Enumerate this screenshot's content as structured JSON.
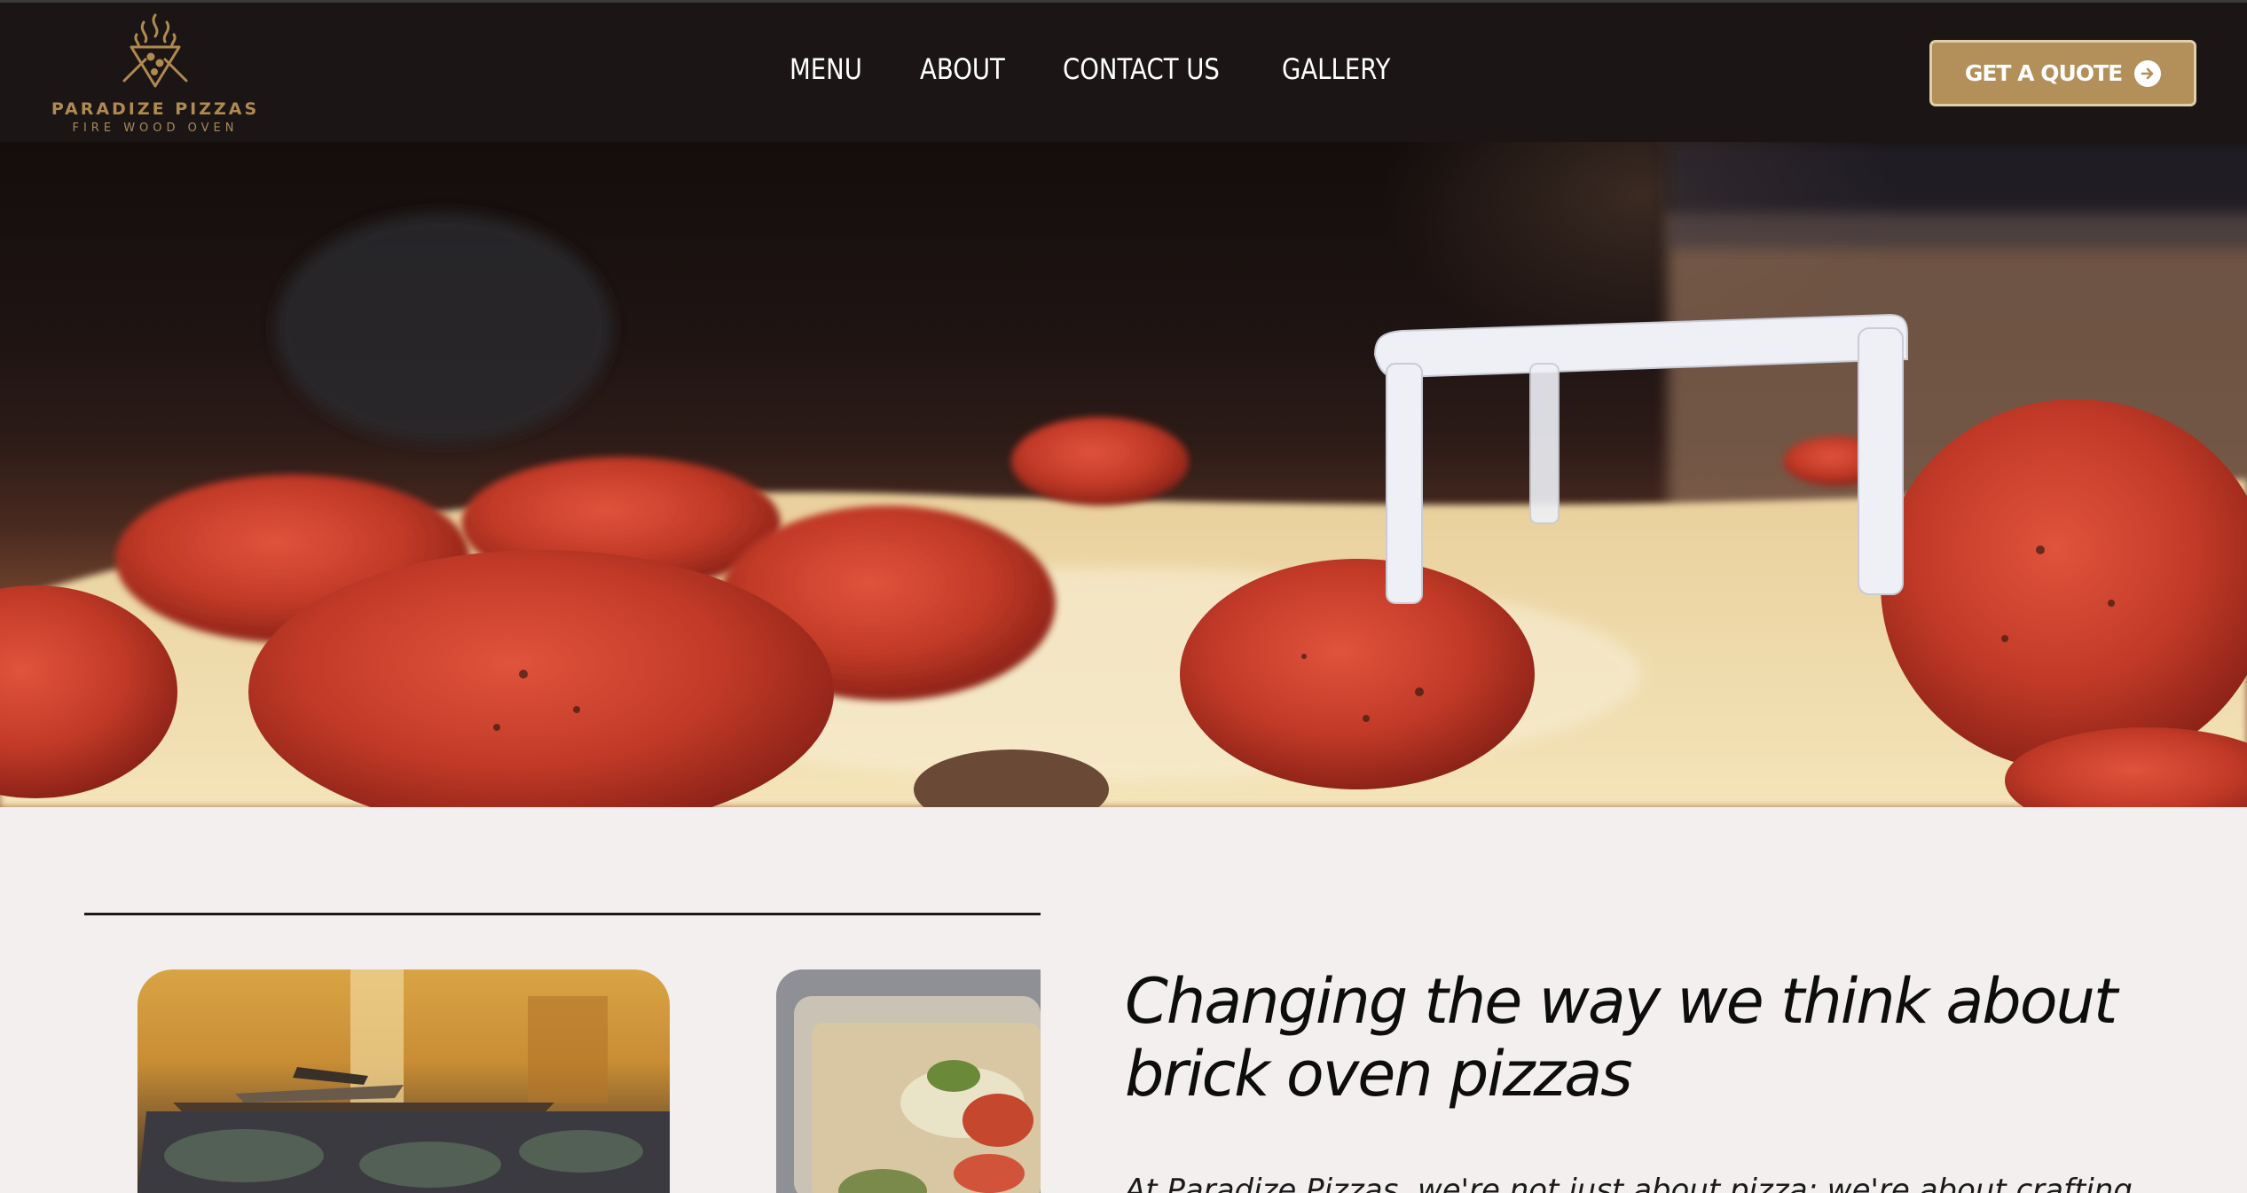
{
  "brand": {
    "name": "PARADIZE PIZZAS",
    "tagline": "FIRE WOOD OVEN",
    "logo_icon": "pizza-flame-logo",
    "accent_color": "#b08a4e",
    "header_bg": "#1b1515"
  },
  "nav": {
    "items": [
      {
        "label": "MENU"
      },
      {
        "label": "ABOUT"
      },
      {
        "label": "CONTACT US"
      },
      {
        "label": "GALLERY"
      }
    ]
  },
  "cta": {
    "label": "GET A QUOTE",
    "icon": "arrow-right-circle-icon",
    "bg_color": "#b38f5a"
  },
  "hero": {
    "image": "pepperoni-pizza-closeup"
  },
  "about": {
    "headline": "Changing the way we think about brick oven pizzas",
    "intro": "At Paradize Pizzas, we're not just about pizza; we're about crafting",
    "photo_left": "restaurant-kitchen-photo",
    "photo_right": "pizza-tray-photo"
  },
  "colors": {
    "page_bg": "#f3efee",
    "text": "#0d0d0d"
  }
}
